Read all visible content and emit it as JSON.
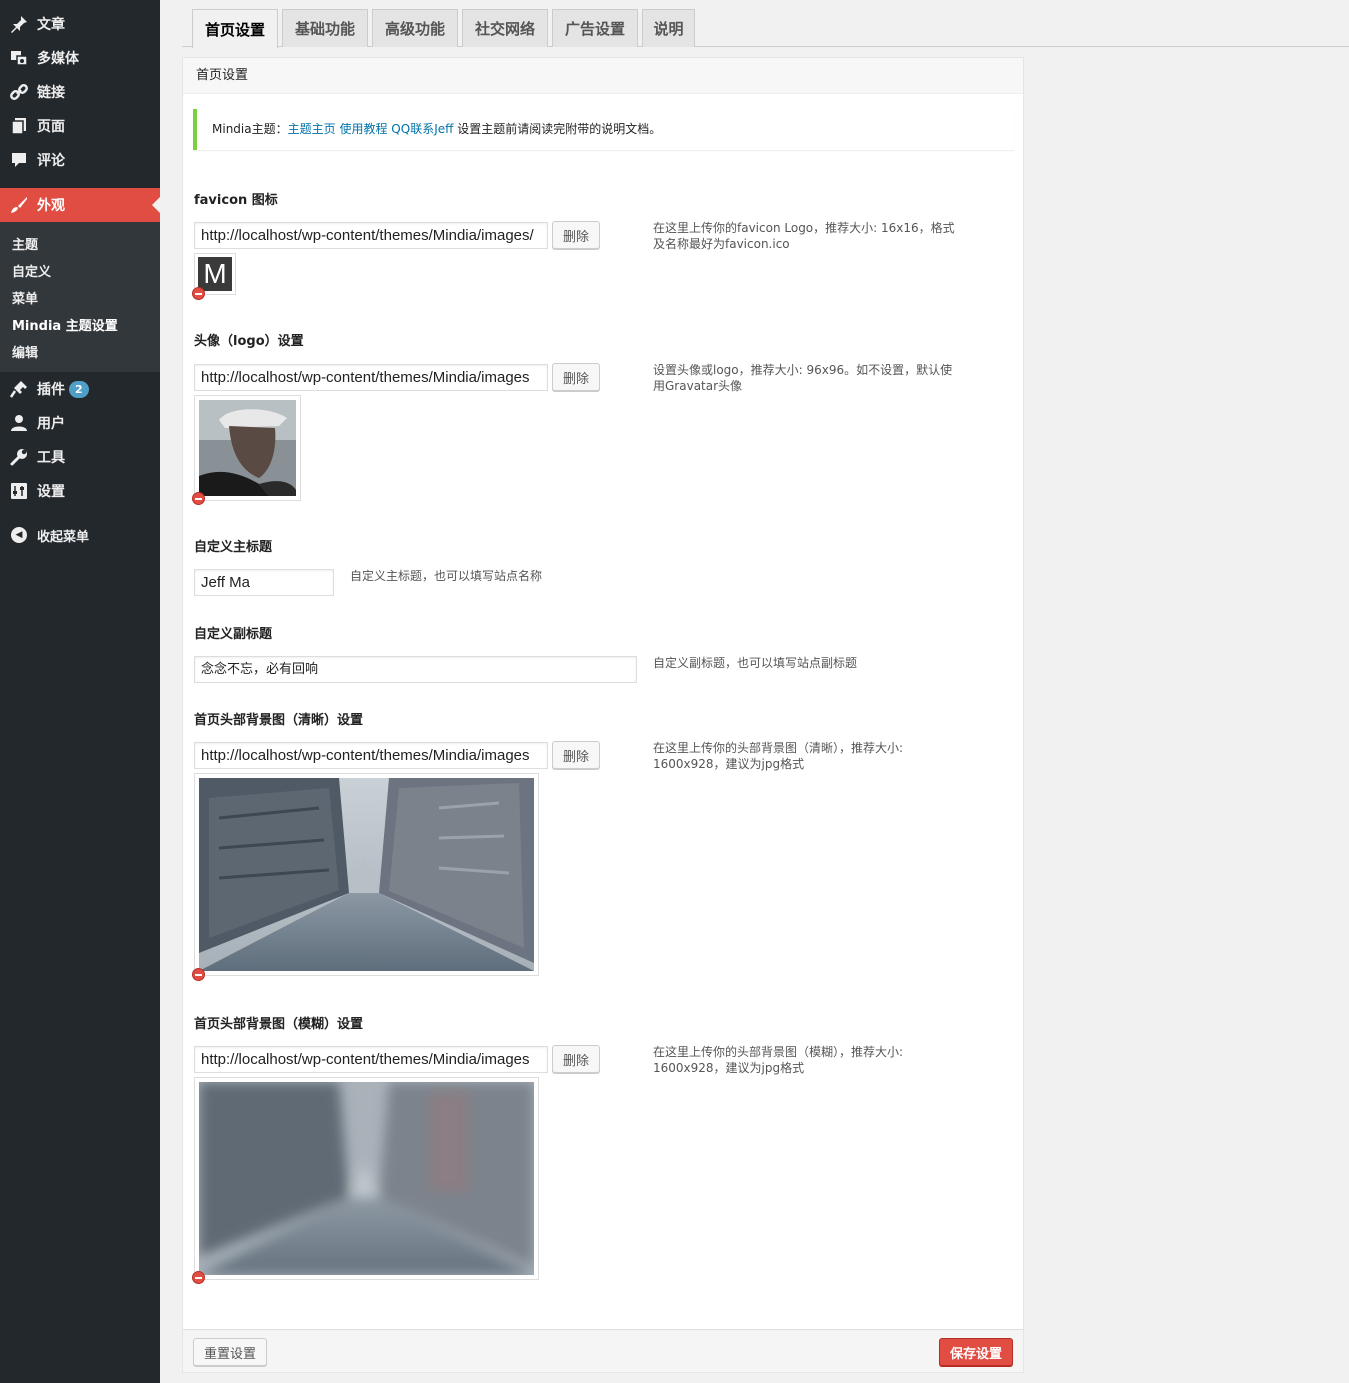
{
  "sidebar": {
    "items": [
      {
        "label": "文章",
        "icon": "pin-icon"
      },
      {
        "label": "多媒体",
        "icon": "media-icon"
      },
      {
        "label": "链接",
        "icon": "link-icon"
      },
      {
        "label": "页面",
        "icon": "page-icon"
      },
      {
        "label": "评论",
        "icon": "comment-icon"
      },
      {
        "label": "外观",
        "icon": "brush-icon"
      },
      {
        "label": "插件",
        "icon": "plugin-icon",
        "badge": "2"
      },
      {
        "label": "用户",
        "icon": "user-icon"
      },
      {
        "label": "工具",
        "icon": "wrench-icon"
      },
      {
        "label": "设置",
        "icon": "settings-icon"
      }
    ],
    "submenu": [
      "主题",
      "自定义",
      "菜单",
      "Mindia 主题设置",
      "编辑"
    ],
    "collapse_label": "收起菜单"
  },
  "tabs": [
    "首页设置",
    "基础功能",
    "高级功能",
    "社交网络",
    "广告设置",
    "说明"
  ],
  "panel": {
    "title": "首页设置",
    "notice": {
      "prefix": "Mindia主题：",
      "link1": "主题主页",
      "link2": "使用教程",
      "link3": "QQ联系Jeff",
      "suffix": " 设置主题前请阅读完附带的说明文档。"
    },
    "favicon": {
      "label": "favicon 图标",
      "value": "http://localhost/wp-content/themes/Mindia/images/",
      "button": "删除",
      "desc": "在这里上传你的favicon Logo，推荐大小: 16x16，格式及名称最好为favicon.ico",
      "preview_letter": "M"
    },
    "avatar": {
      "label": "头像（logo）设置",
      "value": "http://localhost/wp-content/themes/Mindia/images",
      "button": "删除",
      "desc": "设置头像或logo，推荐大小: 96x96。如不设置，默认使用Gravatar头像"
    },
    "main_title": {
      "label": "自定义主标题",
      "value": "Jeff Ma",
      "desc": "自定义主标题，也可以填写站点名称"
    },
    "subtitle": {
      "label": "自定义副标题",
      "value": "念念不忘，必有回响",
      "desc": "自定义副标题，也可以填写站点副标题"
    },
    "header_bg_clear": {
      "label": "首页头部背景图（清晰）设置",
      "value": "http://localhost/wp-content/themes/Mindia/images",
      "button": "删除",
      "desc": "在这里上传你的头部背景图（清晰），推荐大小: 1600x928，建议为jpg格式"
    },
    "header_bg_blur": {
      "label": "首页头部背景图（模糊）设置",
      "value": "http://localhost/wp-content/themes/Mindia/images",
      "button": "删除",
      "desc": "在这里上传你的头部背景图（模糊），推荐大小: 1600x928，建议为jpg格式"
    },
    "reset_button": "重置设置",
    "save_button": "保存设置"
  },
  "colors": {
    "accent": "#e14d43",
    "sidebar": "#23282d",
    "submenu": "#32373c",
    "link": "#0073aa",
    "notice_border": "#7ad03a"
  }
}
